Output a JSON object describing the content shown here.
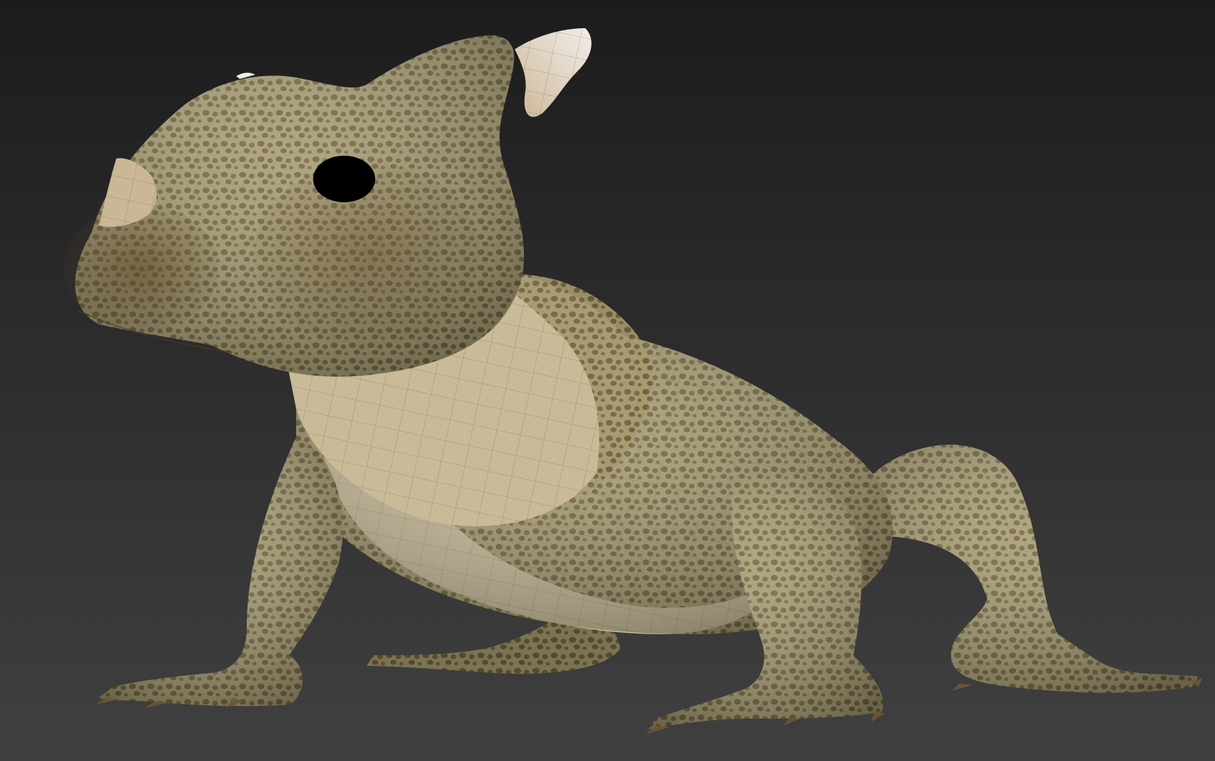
{
  "viewport": {
    "background_top": "#1c1c1c",
    "background_bottom": "#404040"
  },
  "model": {
    "skin_base": "#a39a70",
    "skin_light": "#c2b593",
    "belly": "#c9bb98",
    "spot_dark": "#6b5833",
    "spot_shadow": "#5a4626",
    "horn": "#cbb796",
    "horn_tip": "#f3eeea",
    "eye": "#000000",
    "wire": "#5a4c30"
  }
}
